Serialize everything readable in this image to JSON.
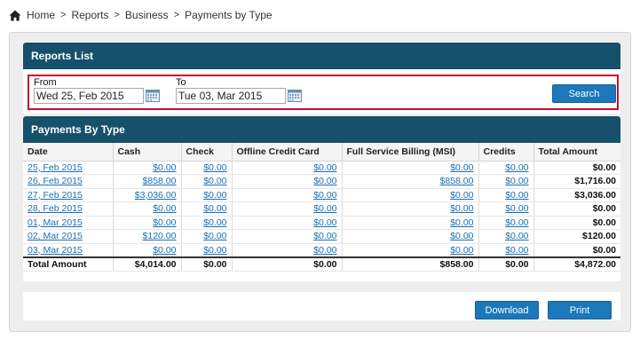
{
  "breadcrumb": {
    "items": [
      "Home",
      "Reports",
      "Business",
      "Payments by Type"
    ],
    "separator": ">"
  },
  "reports_list": {
    "title": "Reports List",
    "from_label": "From",
    "from_value": "Wed 25, Feb 2015",
    "to_label": "To",
    "to_value": "Tue 03, Mar 2015",
    "search_label": "Search"
  },
  "payments": {
    "title": "Payments By Type",
    "columns": [
      "Date",
      "Cash",
      "Check",
      "Offline Credit Card",
      "Full Service Billing (MSI)",
      "Credits",
      "Total Amount"
    ],
    "rows": [
      [
        "25, Feb 2015",
        "$0.00",
        "$0.00",
        "$0.00",
        "$0.00",
        "$0.00",
        "$0.00"
      ],
      [
        "26, Feb 2015",
        "$858.00",
        "$0.00",
        "$0.00",
        "$858.00",
        "$0.00",
        "$1,716.00"
      ],
      [
        "27, Feb 2015",
        "$3,036.00",
        "$0.00",
        "$0.00",
        "$0.00",
        "$0.00",
        "$3,036.00"
      ],
      [
        "28, Feb 2015",
        "$0.00",
        "$0.00",
        "$0.00",
        "$0.00",
        "$0.00",
        "$0.00"
      ],
      [
        "01, Mar 2015",
        "$0.00",
        "$0.00",
        "$0.00",
        "$0.00",
        "$0.00",
        "$0.00"
      ],
      [
        "02, Mar 2015",
        "$120.00",
        "$0.00",
        "$0.00",
        "$0.00",
        "$0.00",
        "$120.00"
      ],
      [
        "03, Mar 2015",
        "$0.00",
        "$0.00",
        "$0.00",
        "$0.00",
        "$0.00",
        "$0.00"
      ]
    ],
    "totals": [
      "Total Amount",
      "$4,014.00",
      "$0.00",
      "$0.00",
      "$858.00",
      "$0.00",
      "$4,872.00"
    ]
  },
  "actions": {
    "download_label": "Download",
    "print_label": "Print"
  },
  "colors": {
    "panel_header": "#17506a",
    "button": "#1b78ba",
    "link": "#1a6fb5",
    "filter_border": "#c8102e"
  },
  "icons": {
    "home": "home-icon",
    "calendar": "calendar-icon"
  }
}
